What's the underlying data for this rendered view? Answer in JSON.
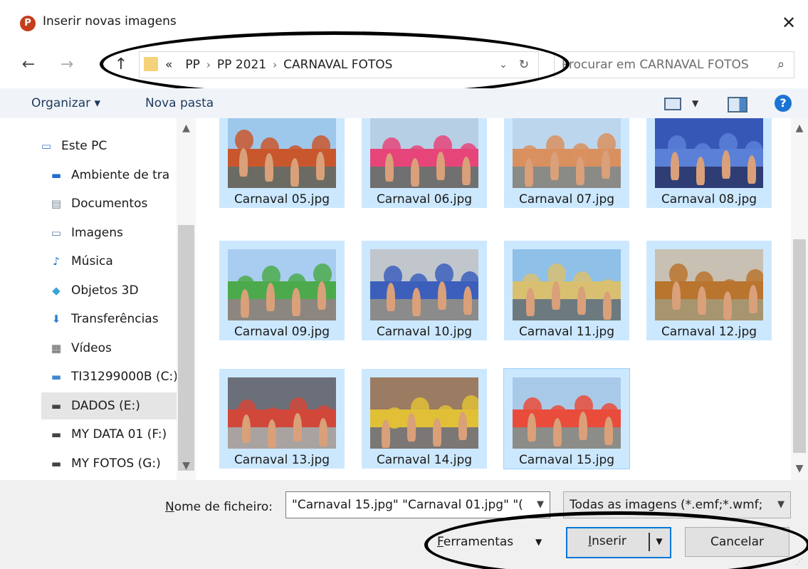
{
  "dialog": {
    "app_icon_letter": "P",
    "title": "Inserir novas imagens",
    "close": "✕"
  },
  "navigation": {
    "back": "←",
    "forward": "→",
    "up": "↑",
    "breadcrumb": [
      "«",
      "PP",
      "PP 2021",
      "CARNAVAL FOTOS"
    ],
    "breadcrumb_sep": "›",
    "refresh": "↻",
    "dropdown": "⌄",
    "search_placeholder": "Procurar em CARNAVAL FOTOS",
    "search_icon": "⌕"
  },
  "toolbar": {
    "organize": "Organizar ▾",
    "new_folder": "Nova pasta",
    "help": "?"
  },
  "sidebar": {
    "items": [
      {
        "label": "Este PC",
        "icon": "computer-icon",
        "color": "#3a7bd5"
      },
      {
        "label": "Ambiente de tra",
        "icon": "desktop-icon",
        "color": "#1f6fd1"
      },
      {
        "label": "Documentos",
        "icon": "documents-icon",
        "color": "#7a8797"
      },
      {
        "label": "Imagens",
        "icon": "pictures-icon",
        "color": "#5b7fa6"
      },
      {
        "label": "Música",
        "icon": "music-icon",
        "color": "#1f6fd1"
      },
      {
        "label": "Objetos 3D",
        "icon": "objects-3d-icon",
        "color": "#35a4d7"
      },
      {
        "label": "Transferências",
        "icon": "downloads-icon",
        "color": "#2f7fd6"
      },
      {
        "label": "Vídeos",
        "icon": "videos-icon",
        "color": "#555555"
      },
      {
        "label": "TI31299000B (C:)",
        "icon": "windows-drive-icon",
        "color": "#3c89d0"
      },
      {
        "label": "DADOS (E:)",
        "icon": "drive-icon",
        "color": "#444444",
        "selected": true
      },
      {
        "label": "MY DATA 01 (F:)",
        "icon": "drive-icon",
        "color": "#444444"
      },
      {
        "label": "MY FOTOS (G:)",
        "icon": "drive-icon",
        "color": "#444444"
      }
    ]
  },
  "files": [
    {
      "name": "Carnaval 05.jpg",
      "sky": "#9ec7ec",
      "mid": "#c9572d",
      "ground": "#6b6b63"
    },
    {
      "name": "Carnaval 06.jpg",
      "sky": "#b7cfe5",
      "mid": "#e6457a",
      "ground": "#707070"
    },
    {
      "name": "Carnaval 07.jpg",
      "sky": "#bcd6ee",
      "mid": "#d9905f",
      "ground": "#8a8a86"
    },
    {
      "name": "Carnaval 08.jpg",
      "sky": "#3757b7",
      "mid": "#5a80d8",
      "ground": "#2f3d75"
    },
    {
      "name": "Carnaval 09.jpg",
      "sky": "#a8cdf0",
      "mid": "#4caa4c",
      "ground": "#8b8780"
    },
    {
      "name": "Carnaval 10.jpg",
      "sky": "#c0c6cc",
      "mid": "#3c5fbc",
      "ground": "#8b8b8b"
    },
    {
      "name": "Carnaval 11.jpg",
      "sky": "#8ec0e8",
      "mid": "#d8c070",
      "ground": "#6c7a80"
    },
    {
      "name": "Carnaval 12.jpg",
      "sky": "#c7c0b3",
      "mid": "#b9742e",
      "ground": "#a7956f"
    },
    {
      "name": "Carnaval 13.jpg",
      "sky": "#6b6f79",
      "mid": "#d1483a",
      "ground": "#a8a3a0"
    },
    {
      "name": "Carnaval 14.jpg",
      "sky": "#9b7b62",
      "mid": "#e0c037",
      "ground": "#7b7775"
    },
    {
      "name": "Carnaval 15.jpg",
      "sky": "#a9c9e8",
      "mid": "#e94c3b",
      "ground": "#8c8c88",
      "focused": true
    }
  ],
  "footer": {
    "filename_label_u": "N",
    "filename_label_rest": "ome de ficheiro:",
    "filename_value": "\"Carnaval 15.jpg\" \"Carnaval 01.jpg\" \"(",
    "filter_value": "Todas as imagens (*.emf;*.wmf;",
    "tools_u": "F",
    "tools_rest": "erramentas",
    "insert_u": "I",
    "insert_rest": "nserir",
    "cancel": "Cancelar"
  }
}
